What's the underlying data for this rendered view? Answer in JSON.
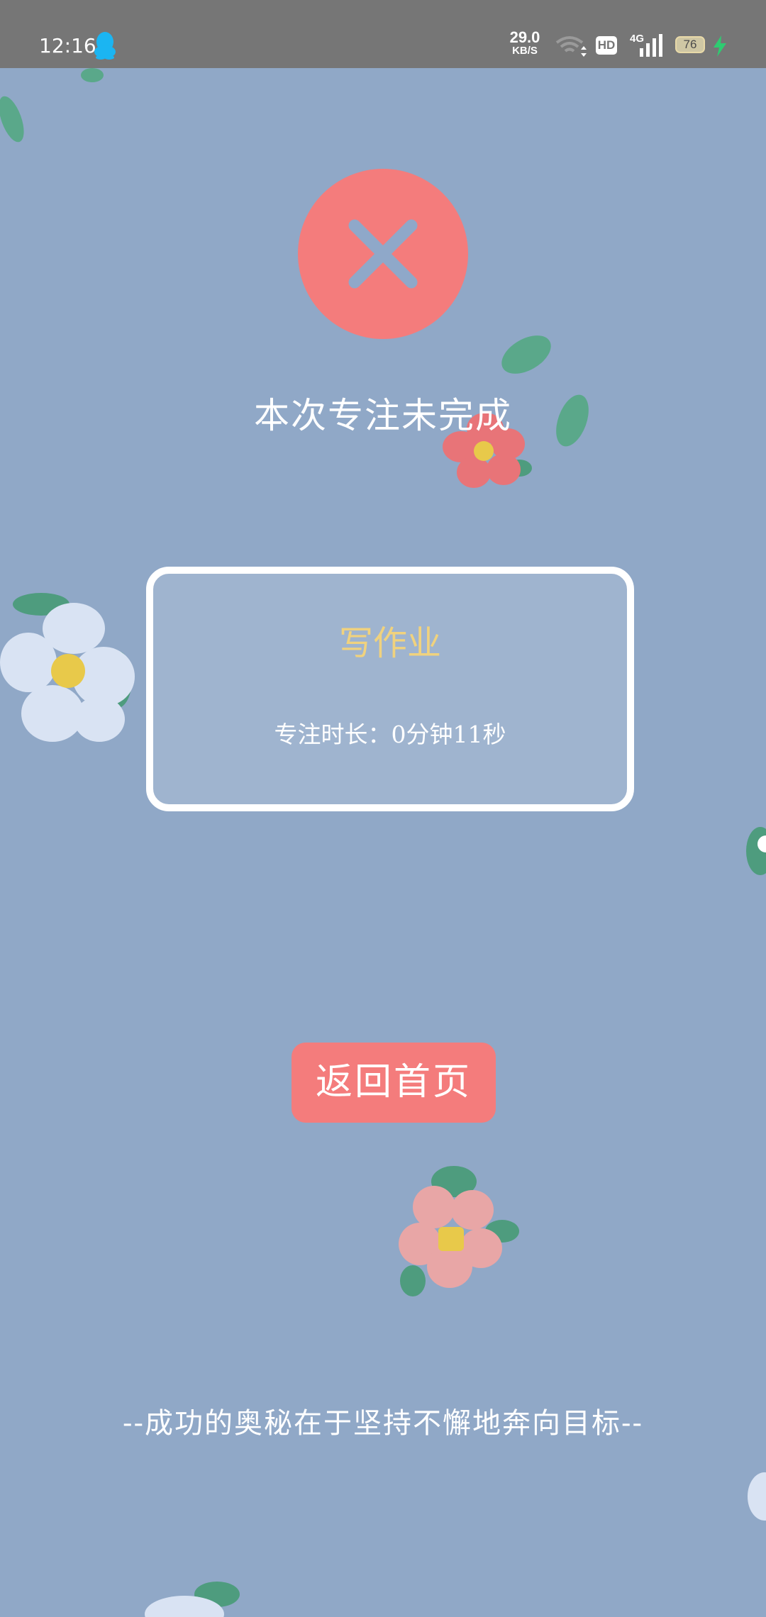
{
  "status_bar": {
    "time": "12:16",
    "network_speed": "29.0",
    "network_speed_unit": "KB/S",
    "hd_label": "HD",
    "signal_label": "4G",
    "battery_level": "76",
    "icons": [
      "qq-icon",
      "wifi-icon",
      "hd-icon",
      "signal-icon",
      "battery-icon",
      "charging-icon"
    ]
  },
  "result": {
    "icon": "close-icon",
    "title": "本次专注未完成"
  },
  "task_card": {
    "task_name": "写作业",
    "focus_duration": "专注时长：0分钟11秒"
  },
  "actions": {
    "home_button": "返回首页"
  },
  "footer": {
    "motto": "--成功的奥秘在于坚持不懈地奔向目标--"
  },
  "colors": {
    "background": "#90a8c7",
    "accent_red": "#f47c7c",
    "task_name_yellow": "#f0d27e",
    "status_bar": "#767676"
  }
}
